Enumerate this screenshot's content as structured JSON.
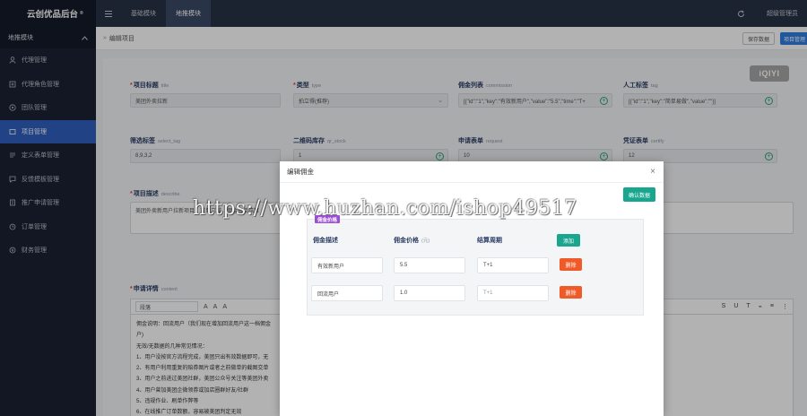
{
  "sidebar": {
    "brand": "云创优品后台",
    "brand_mark": "®",
    "group": "地推模块",
    "items": [
      {
        "label": "代理管理",
        "icon": "user-icon"
      },
      {
        "label": "代理角色管理",
        "icon": "role-icon"
      },
      {
        "label": "团队管理",
        "icon": "team-icon"
      },
      {
        "label": "项目管理",
        "icon": "project-icon",
        "active": true
      },
      {
        "label": "定义表单管理",
        "icon": "form-icon"
      },
      {
        "label": "反馈模板管理",
        "icon": "feedback-icon"
      },
      {
        "label": "推广申请管理",
        "icon": "apply-icon"
      },
      {
        "label": "订单管理",
        "icon": "order-icon"
      },
      {
        "label": "财务管理",
        "icon": "finance-icon"
      }
    ]
  },
  "topbar": {
    "tabs": [
      "基础模块",
      "地推模块"
    ],
    "active_tab": 1,
    "admin": "超级管理员"
  },
  "breadcrumb": {
    "sep": "»",
    "current": "编辑项目",
    "save_button": "保存数据",
    "back_button": "项目管理"
  },
  "watermark_logo": "iQIYI",
  "form": {
    "title": {
      "label": "项目标题",
      "en": "title",
      "value": "美团外卖拉新"
    },
    "type": {
      "label": "类型",
      "en": "type",
      "value": "拍立得(推荐)"
    },
    "commission": {
      "label": "佣金列表",
      "en": "commission",
      "value": "[{\"id\":\"1\",\"key\":\"有效新用户\",\"value\":\"5.5\",\"time\":\"T+"
    },
    "tag": {
      "label": "人工标签",
      "en": "tag",
      "value": "[{\"id\":\"1\",\"key\":\"简单易做\",\"value\":\"\"}]"
    },
    "select_tag": {
      "label": "筛选标签",
      "en": "select_tag",
      "value": "8,9,3,2"
    },
    "stock": {
      "label": "二维码库存",
      "en": "qr_stock",
      "value": "1"
    },
    "request": {
      "label": "申请表单",
      "en": "request",
      "value": "10"
    },
    "certify": {
      "label": "凭证表单",
      "en": "certify",
      "value": "12"
    },
    "describe": {
      "label": "项目描述",
      "en": "describe",
      "value": "美团外卖新用户拉新项目，首单立减，佣金每单结算"
    },
    "content": {
      "label": "申请详情",
      "en": "content",
      "paragraph": "段落",
      "lines": [
        "佣金说明：回流用户（我们现在增加回流用户这一档佣金",
        "户)",
        "无效/无数据的几种常见情况：",
        "1、用户没按官方流程完成，美团只出有效数据即可，无",
        "2、有用户利用重复的赔券图片或者之前做单的截图交单",
        "3、用户之前进过美团社群，美团公众号关注等美团外卖",
        "4、用户曾加美团企微领券或加店圈群好友/社群",
        "5、违规作业、刷单作弊等",
        "6、在线推广订单数额，容易被美团判定无效"
      ]
    }
  },
  "modal": {
    "title": "编辑佣金",
    "confirm": "确认数据",
    "tag": "佣金价格",
    "headers": {
      "desc": "佣金描述",
      "price": "佣金价格",
      "price_unit": "(元)",
      "period": "结算周期",
      "add": "添加"
    },
    "rows": [
      {
        "desc": "有效新用户",
        "price": "5.5",
        "period": "T+1",
        "delete": "删除"
      },
      {
        "desc": "回流用户",
        "price": "1.0",
        "period": "T+1",
        "delete": "删除"
      }
    ]
  },
  "url_watermark": "https://www.huzhan.com/ishop49517"
}
